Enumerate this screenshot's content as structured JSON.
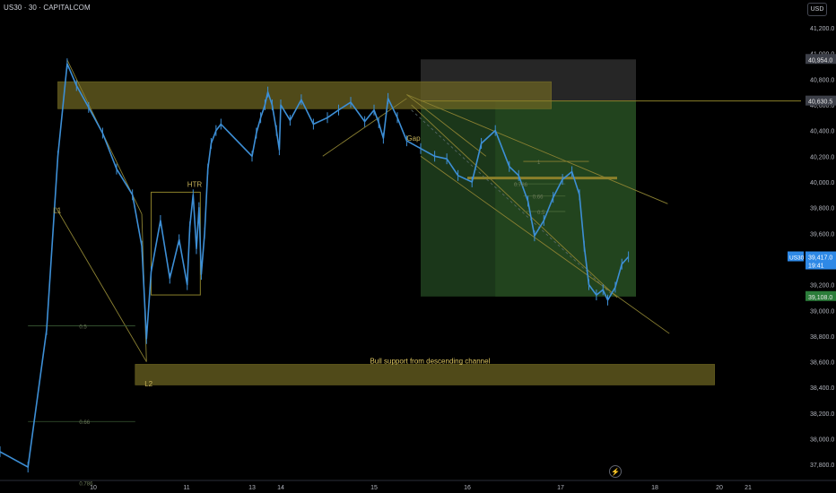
{
  "header": {
    "symbol_line": "US30 · 30 · CAPITALCOM",
    "currency": "USD"
  },
  "colors": {
    "up": "#3d8fd6",
    "zone_fill": "#6b6322",
    "zone_stroke": "#8a7f2a",
    "trend": "#8b8132",
    "green": "#2e5a2a",
    "price_tag": "#2e89e6",
    "tp_tag": "#2b7d3a",
    "axis_text": "#b2b5be"
  },
  "chart_data": {
    "type": "candlestick",
    "title": "US30 · 30 · CAPITALCOM",
    "x_ticks": [
      "10",
      "11",
      "13",
      "14",
      "15",
      "16",
      "17",
      "18",
      "20",
      "21"
    ],
    "y_ticks": [
      37800,
      38000,
      38200,
      38400,
      38600,
      38800,
      39000,
      39200,
      39400,
      39600,
      39800,
      40000,
      40200,
      40400,
      40600,
      40800,
      41000,
      41200
    ],
    "y_tick_labels": [
      "37,800.0",
      "38,000.0",
      "38,200.0",
      "38,400.0",
      "38,600.0",
      "38,800.0",
      "39,000.0",
      "39,200.0",
      "39,400.0",
      "39,600.0",
      "39,800.0",
      "40,000.0",
      "40,200.0",
      "40,400.0",
      "40,600.0",
      "40,800.0",
      "41,000.0",
      "41,200.0"
    ],
    "ylim": [
      37700,
      41380
    ],
    "price_path": [
      {
        "day": 9.0,
        "price": 37900
      },
      {
        "day": 9.3,
        "price": 37780
      },
      {
        "day": 9.5,
        "price": 38850
      },
      {
        "day": 9.62,
        "price": 40200
      },
      {
        "day": 9.72,
        "price": 40920
      },
      {
        "day": 9.82,
        "price": 40750
      },
      {
        "day": 9.95,
        "price": 40580
      },
      {
        "day": 10.1,
        "price": 40380
      },
      {
        "day": 10.25,
        "price": 40100
      },
      {
        "day": 10.42,
        "price": 39900
      },
      {
        "day": 10.52,
        "price": 39500
      },
      {
        "day": 10.57,
        "price": 38780
      },
      {
        "day": 10.62,
        "price": 39300
      },
      {
        "day": 10.72,
        "price": 39700
      },
      {
        "day": 10.82,
        "price": 39250
      },
      {
        "day": 10.92,
        "price": 39550
      },
      {
        "day": 11.02,
        "price": 39200
      },
      {
        "day": 11.1,
        "price": 39650
      },
      {
        "day": 11.2,
        "price": 39900
      },
      {
        "day": 11.3,
        "price": 39480
      },
      {
        "day": 11.38,
        "price": 39800
      },
      {
        "day": 11.45,
        "price": 39280
      },
      {
        "day": 11.55,
        "price": 39600
      },
      {
        "day": 11.65,
        "price": 40100
      },
      {
        "day": 11.75,
        "price": 40300
      },
      {
        "day": 11.9,
        "price": 40400
      },
      {
        "day": 12.05,
        "price": 40450
      },
      {
        "day": 13.0,
        "price": 40200
      },
      {
        "day": 13.15,
        "price": 40380
      },
      {
        "day": 13.3,
        "price": 40500
      },
      {
        "day": 13.45,
        "price": 40600
      },
      {
        "day": 13.55,
        "price": 40700
      },
      {
        "day": 13.7,
        "price": 40600
      },
      {
        "day": 13.85,
        "price": 40400
      },
      {
        "day": 13.95,
        "price": 40250
      },
      {
        "day": 14.0,
        "price": 40600
      },
      {
        "day": 14.1,
        "price": 40480
      },
      {
        "day": 14.22,
        "price": 40640
      },
      {
        "day": 14.35,
        "price": 40450
      },
      {
        "day": 14.5,
        "price": 40500
      },
      {
        "day": 14.62,
        "price": 40560
      },
      {
        "day": 14.75,
        "price": 40620
      },
      {
        "day": 14.9,
        "price": 40470
      },
      {
        "day": 15.0,
        "price": 40560
      },
      {
        "day": 15.05,
        "price": 40460
      },
      {
        "day": 15.1,
        "price": 40340
      },
      {
        "day": 15.15,
        "price": 40650
      },
      {
        "day": 15.25,
        "price": 40500
      },
      {
        "day": 15.35,
        "price": 40320
      },
      {
        "day": 15.5,
        "price": 40260
      },
      {
        "day": 15.65,
        "price": 40200
      },
      {
        "day": 15.78,
        "price": 40180
      },
      {
        "day": 15.9,
        "price": 40050
      },
      {
        "day": 16.05,
        "price": 40000
      },
      {
        "day": 16.15,
        "price": 40300
      },
      {
        "day": 16.3,
        "price": 40400
      },
      {
        "day": 16.45,
        "price": 40120
      },
      {
        "day": 16.55,
        "price": 40050
      },
      {
        "day": 16.65,
        "price": 39850
      },
      {
        "day": 16.72,
        "price": 39580
      },
      {
        "day": 16.82,
        "price": 39700
      },
      {
        "day": 16.92,
        "price": 39880
      },
      {
        "day": 17.02,
        "price": 40020
      },
      {
        "day": 17.12,
        "price": 40080
      },
      {
        "day": 17.2,
        "price": 39900
      },
      {
        "day": 17.25,
        "price": 39500
      },
      {
        "day": 17.3,
        "price": 39200
      },
      {
        "day": 17.38,
        "price": 39120
      },
      {
        "day": 17.45,
        "price": 39160
      },
      {
        "day": 17.5,
        "price": 39080
      },
      {
        "day": 17.58,
        "price": 39180
      },
      {
        "day": 17.65,
        "price": 39360
      },
      {
        "day": 17.72,
        "price": 39417
      }
    ],
    "current_price": {
      "price": 39417,
      "label": "39,417.0",
      "countdown": "19:41",
      "symbol": "US30"
    },
    "levels": [
      {
        "price": 40954,
        "label": "40,954.0"
      },
      {
        "price": 40630,
        "label": "40,630.5"
      },
      {
        "price": 39108,
        "label": "39,108.0"
      }
    ],
    "annotations": [
      {
        "text": "L1",
        "day": 9.57,
        "price": 39760
      },
      {
        "text": "L2",
        "day": 10.55,
        "price": 38410
      },
      {
        "text": "HTR",
        "day": 11.02,
        "price": 39960
      },
      {
        "text": "Gap",
        "day": 15.35,
        "price": 40320
      },
      {
        "text": "Bull support from descending channel",
        "day": 15.6,
        "price": 38585
      }
    ],
    "fib_labels": [
      {
        "text": "0.5",
        "day": 9.85,
        "price": 38880
      },
      {
        "text": "0.66",
        "day": 9.85,
        "price": 38135
      },
      {
        "text": "0.786",
        "day": 9.85,
        "price": 37660
      },
      {
        "text": "1",
        "day": 16.75,
        "price": 40160
      },
      {
        "text": "0.786",
        "day": 16.5,
        "price": 39985
      },
      {
        "text": "0.66",
        "day": 16.7,
        "price": 39890
      },
      {
        "text": "0.5",
        "day": 16.75,
        "price": 39770
      }
    ],
    "zones": [
      {
        "name": "supply",
        "day_from": 9.62,
        "day_to": 16.9,
        "price_low": 40570,
        "price_high": 40780
      },
      {
        "name": "support",
        "day_from": 10.45,
        "day_to": 19.85,
        "price_low": 38420,
        "price_high": 38580
      },
      {
        "name": "htr-box",
        "day_from": 10.62,
        "day_to": 11.42,
        "price_low": 39120,
        "price_high": 39920
      }
    ],
    "position": {
      "entry": 40630.5,
      "stop": 40954,
      "target": 39108,
      "day_from": 15.5,
      "day_to": 17.8
    }
  }
}
